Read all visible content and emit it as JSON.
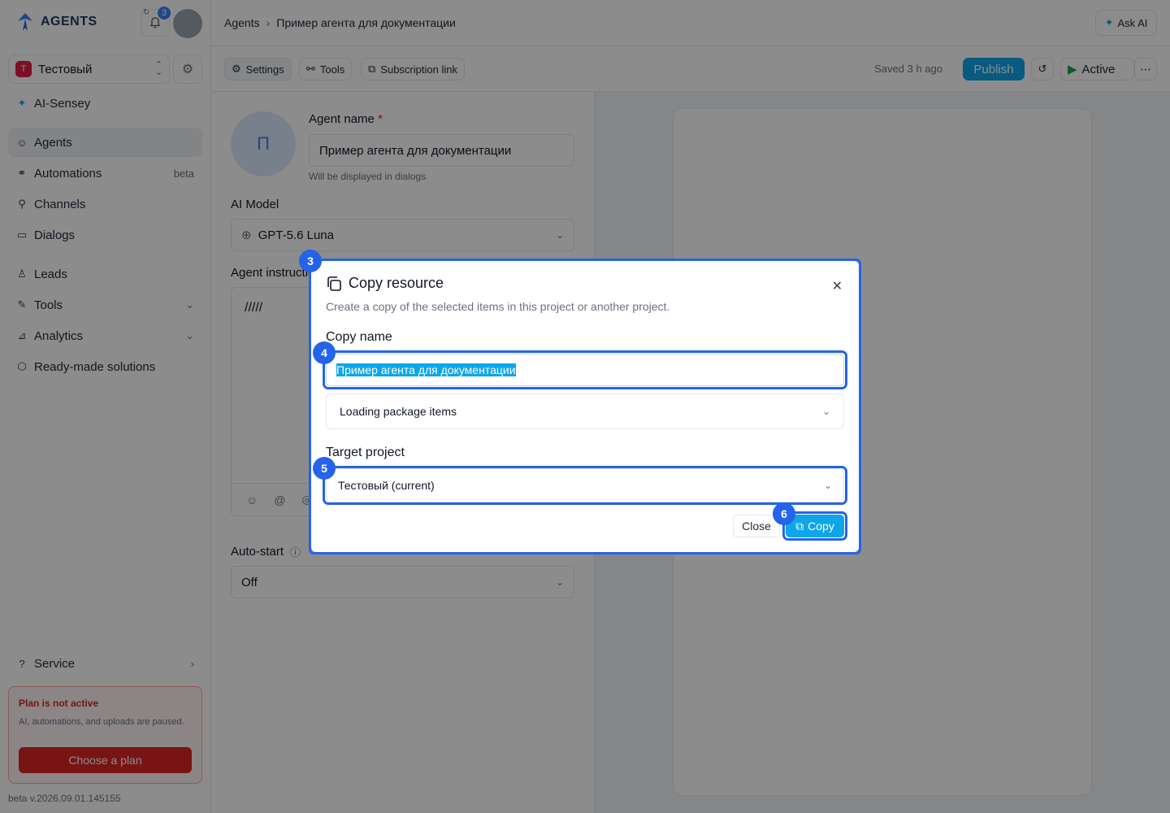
{
  "app": {
    "logo_text": "AGENTS",
    "notification_count": "3",
    "ask_ai_label": "Ask AI"
  },
  "project": {
    "letter": "Т",
    "name": "Тестовый"
  },
  "sidebar": {
    "brand_item": "AI-Sensey",
    "items": [
      {
        "label": "Agents"
      },
      {
        "label": "Automations",
        "badge": "beta"
      },
      {
        "label": "Channels"
      },
      {
        "label": "Dialogs"
      },
      {
        "label": "Leads"
      },
      {
        "label": "Tools"
      },
      {
        "label": "Analytics"
      },
      {
        "label": "Ready-made solutions"
      }
    ],
    "service_label": "Service",
    "plan": {
      "title": "Plan is not active",
      "description": "AI, automations, and uploads are paused.",
      "button": "Choose a plan"
    },
    "version": "beta v.2026.09.01.145155"
  },
  "breadcrumb": {
    "root": "Agents",
    "current": "Пример агента для документации"
  },
  "toolbar": {
    "settings": "Settings",
    "tools": "Tools",
    "subscription": "Subscription link",
    "saved": "Saved 3 h ago",
    "publish": "Publish",
    "status": "Active"
  },
  "form": {
    "avatar_letter": "П",
    "agent_name_label": "Agent name",
    "agent_name_required": "*",
    "agent_name_value": "Пример агента для документации",
    "agent_name_hint": "Will be displayed in dialogs",
    "model_label": "AI Model",
    "model_value": "GPT-5.6 Luna",
    "instructions_label": "Agent instructions",
    "instructions_value": "/////",
    "autostart_label": "Auto-start",
    "autostart_value": "Off"
  },
  "modal": {
    "title": "Copy resource",
    "description": "Create a copy of the selected items in this project or another project.",
    "copy_name_label": "Copy name",
    "copy_name_value": "Пример агента для документации",
    "package_items": "Loading package items",
    "target_project_label": "Target project",
    "target_project_value": "Тестовый (current)",
    "close_button": "Close",
    "copy_button": "Copy"
  },
  "annotations": {
    "b3": "3",
    "b4": "4",
    "b5": "5",
    "b6": "6"
  },
  "colors": {
    "accent": "#0ea5e9",
    "highlight": "#2563eb",
    "danger": "#dc2626"
  }
}
